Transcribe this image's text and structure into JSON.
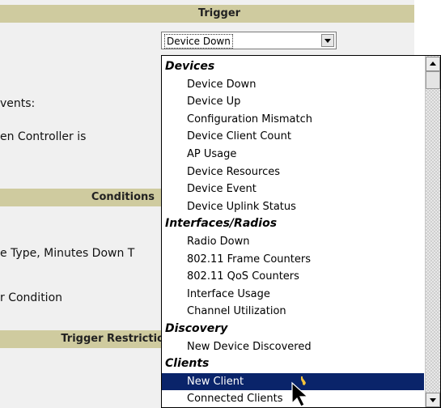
{
  "sections": {
    "trigger_header": "Trigger",
    "conditions_header": "Conditions",
    "restriction_header": "Trigger Restrictio"
  },
  "labels": {
    "events": "vents:",
    "controller": "en Controller is",
    "type": "e Type, Minutes Down T",
    "condition": "r Condition"
  },
  "combo": {
    "selected_value": "Device Down"
  },
  "dropdown": {
    "groups": [
      {
        "name": "Devices",
        "items": [
          "Device Down",
          "Device Up",
          "Configuration Mismatch",
          "Device Client Count",
          "AP Usage",
          "Device Resources",
          "Device Event",
          "Device Uplink Status"
        ]
      },
      {
        "name": "Interfaces/Radios",
        "items": [
          "Radio Down",
          "802.11 Frame Counters",
          "802.11 QoS Counters",
          "Interface Usage",
          "Channel Utilization"
        ]
      },
      {
        "name": "Discovery",
        "items": [
          "New Device Discovered"
        ]
      },
      {
        "name": "Clients",
        "items": [
          "New Client",
          "Connected Clients"
        ]
      }
    ],
    "highlighted_item": "New Client"
  },
  "colors": {
    "section_header_bg": "#cfcb9f",
    "panel_bg": "#f0f0f0",
    "selection_bg": "#0a246a",
    "selection_text": "#ffffff"
  },
  "icons": {
    "combo_button": "chevron-down-icon",
    "scroll_up": "arrow-up-icon",
    "scroll_down": "arrow-down-icon",
    "cursor": "mouse-pointer-icon"
  }
}
